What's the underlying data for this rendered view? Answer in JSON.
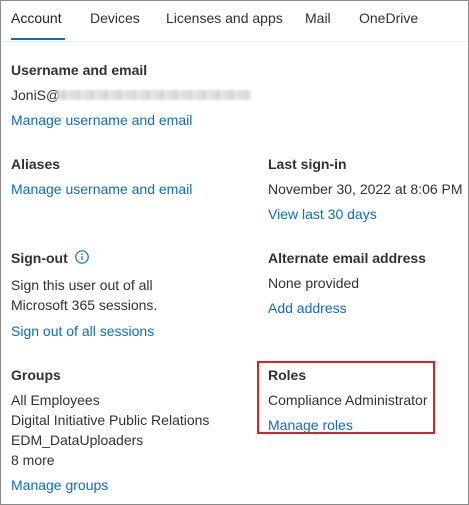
{
  "tabs": [
    "Account",
    "Devices",
    "Licenses and apps",
    "Mail",
    "OneDrive"
  ],
  "username_section": {
    "heading": "Username and email",
    "username_prefix": "JoniS@",
    "link": "Manage username and email"
  },
  "aliases": {
    "heading": "Aliases",
    "link": "Manage username and email"
  },
  "last_signin": {
    "heading": "Last sign-in",
    "value": "November 30, 2022 at 8:06 PM",
    "link": "View last 30 days"
  },
  "signout": {
    "heading": "Sign-out",
    "line1": "Sign this user out of all",
    "line2": "Microsoft 365 sessions.",
    "link": "Sign out of all sessions"
  },
  "alternate_email": {
    "heading": "Alternate email address",
    "value": "None provided",
    "link": "Add address"
  },
  "groups": {
    "heading": "Groups",
    "items": [
      "All Employees",
      "Digital Initiative Public Relations",
      "EDM_DataUploaders"
    ],
    "more": "8 more",
    "link": "Manage groups"
  },
  "roles": {
    "heading": "Roles",
    "value": "Compliance Administrator",
    "link": "Manage roles"
  },
  "colors": {
    "accent": "#0f6cbd",
    "highlight": "#d92128",
    "text": "#323130"
  },
  "icons": {
    "signout_info": "info-icon"
  }
}
